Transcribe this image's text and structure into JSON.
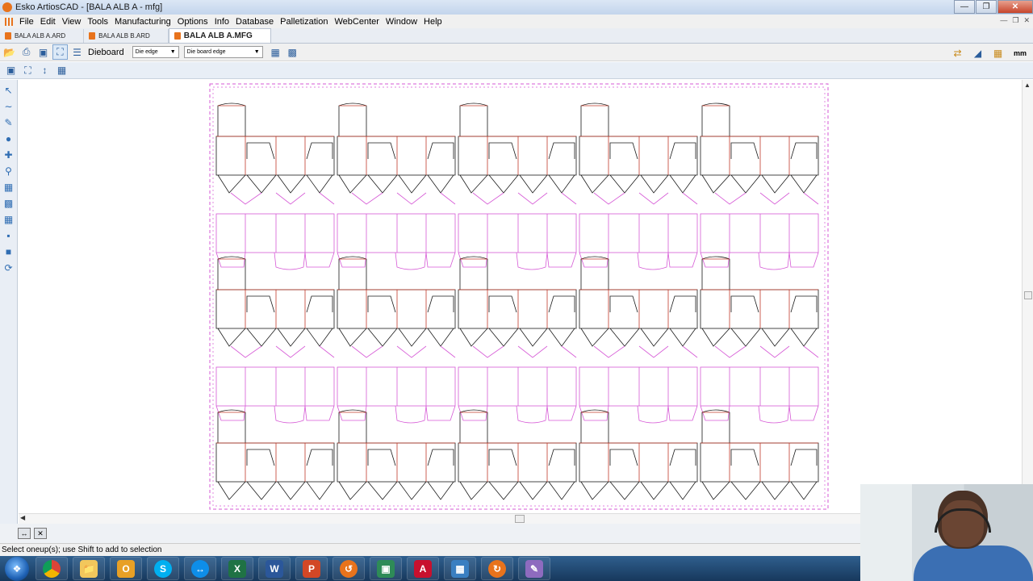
{
  "window": {
    "title": "Esko ArtiosCAD - [BALA ALB A - mfg]",
    "controls": [
      "minimize-icon",
      "restore-icon",
      "close-icon"
    ]
  },
  "menu": [
    "File",
    "Edit",
    "View",
    "Tools",
    "Manufacturing",
    "Options",
    "Info",
    "Database",
    "Palletization",
    "WebCenter",
    "Window",
    "Help"
  ],
  "tabs": [
    {
      "label": "BALA ALB A.ARD",
      "active": false
    },
    {
      "label": "BALA ALB B.ARD",
      "active": false
    },
    {
      "label": "BALA ALB A.MFG",
      "active": true
    }
  ],
  "toolbar": {
    "dieboard_label": "Dieboard",
    "die_edge_select": "Die edge",
    "die_board_edge_select": "Die board edge",
    "units": "mm"
  },
  "status": {
    "message": "Select oneup(s); use Shift to add to selection"
  },
  "colors": {
    "cut_line": "#1a1a1a",
    "crease_line": "#c23a2a",
    "outline_magenta": "#d65ad6",
    "accent": "#e8731c"
  },
  "taskbar_apps": [
    "chrome",
    "explorer",
    "outlook",
    "skype",
    "teamviewer",
    "excel",
    "word",
    "powerpoint",
    "artioscad",
    "unknown-app",
    "acrobat",
    "network-app",
    "artioscad-2",
    "paint"
  ]
}
